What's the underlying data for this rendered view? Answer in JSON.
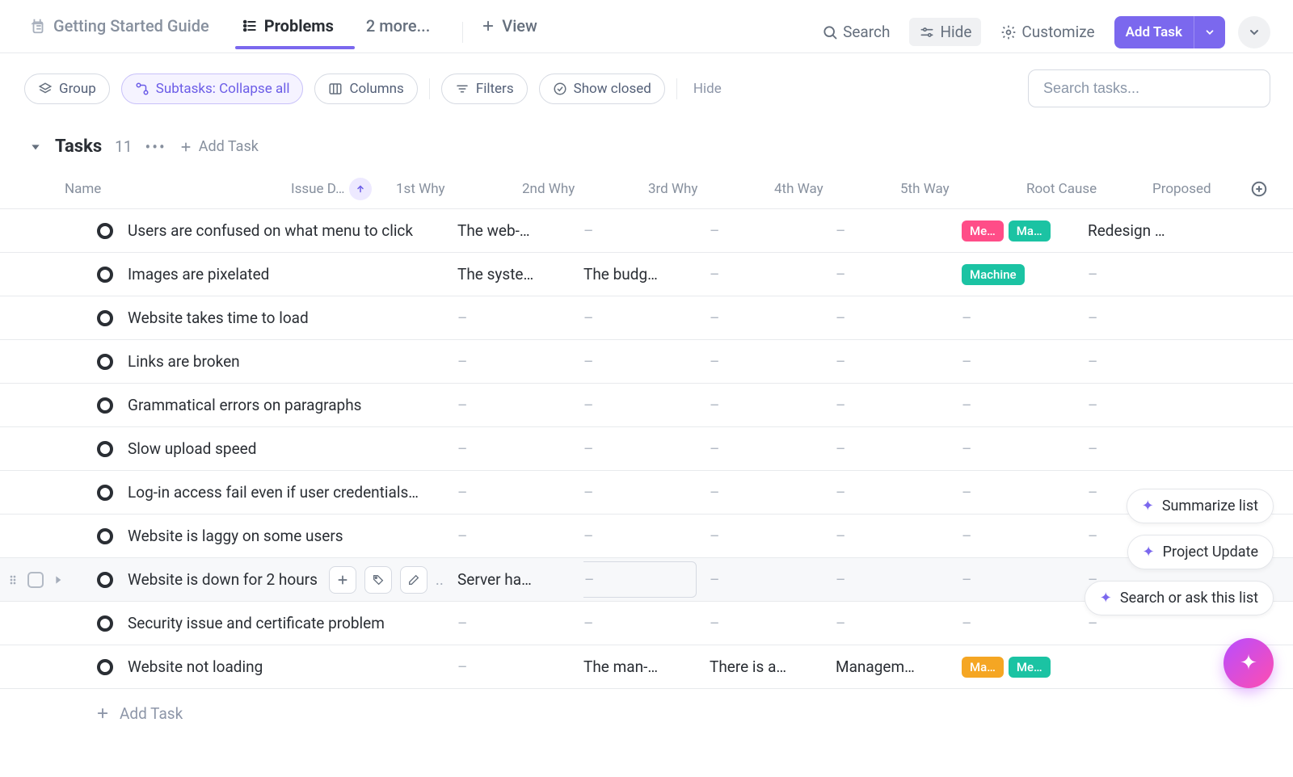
{
  "header": {
    "tabs": [
      {
        "id": "guide",
        "label": "Getting Started Guide",
        "icon": "doc-pin"
      },
      {
        "id": "problems",
        "label": "Problems",
        "icon": "list",
        "active": true
      },
      {
        "id": "more",
        "label": "2 more..."
      }
    ],
    "add_view_label": "View",
    "search_label": "Search",
    "hide_label": "Hide",
    "customize_label": "Customize",
    "add_task_label": "Add Task"
  },
  "filters": {
    "group_label": "Group",
    "subtasks_label": "Subtasks: Collapse all",
    "columns_label": "Columns",
    "filters_label": "Filters",
    "show_closed_label": "Show closed",
    "hide_label": "Hide",
    "search_placeholder": "Search tasks..."
  },
  "group": {
    "title": "Tasks",
    "count": "11",
    "add_task_label": "Add Task"
  },
  "columns": {
    "name": "Name",
    "issue": "Issue D…",
    "why1": "1st Why",
    "why2": "2nd Why",
    "why3": "3rd Why",
    "way4": "4th Way",
    "way5": "5th Way",
    "root": "Root Cause",
    "proposed": "Proposed"
  },
  "rows": [
    {
      "status": "yellow",
      "name": "Users are confused on what menu to click",
      "why1": ".",
      "why2": "The web-…",
      "why3": "–",
      "way4": "–",
      "way5": "–",
      "root_tags": [
        {
          "text": "Me…",
          "color": "pink"
        },
        {
          "text": "Ma…",
          "color": "teal"
        }
      ],
      "proposed": "Redesign …"
    },
    {
      "status": "orange",
      "name": "Images are pixelated",
      "why1": ".",
      "why2": "The syste…",
      "why3": "The budg…",
      "way4": "–",
      "way5": "–",
      "root_tags": [
        {
          "text": "Machine",
          "color": "teal",
          "wide": true
        }
      ],
      "proposed": "–"
    },
    {
      "status": "grey",
      "name": "Website takes time to load",
      "why1": "",
      "why2": "–",
      "why3": "–",
      "way4": "–",
      "way5": "–",
      "root_tags": [],
      "proposed": "–"
    },
    {
      "status": "grey",
      "name": "Links are broken",
      "why1": "",
      "why2": "–",
      "why3": "–",
      "way4": "–",
      "way5": "–",
      "root_tags": [],
      "proposed": "–"
    },
    {
      "status": "purple",
      "name": "Grammatical errors on paragraphs",
      "why1": "",
      "why2": "–",
      "why3": "–",
      "way4": "–",
      "way5": "–",
      "root_tags": [],
      "proposed": "–"
    },
    {
      "status": "grey",
      "name": "Slow upload speed",
      "why1": "",
      "why2": "–",
      "why3": "–",
      "way4": "–",
      "way5": "–",
      "root_tags": [],
      "proposed": "–"
    },
    {
      "status": "purple",
      "name": "Log-in access fail even if user credentials…",
      "why1": ".",
      "why2": "–",
      "why3": "–",
      "way4": "–",
      "way5": "–",
      "root_tags": [],
      "proposed": "–"
    },
    {
      "status": "purple",
      "name": "Website is laggy on some users",
      "why1": "",
      "why2": "–",
      "why3": "–",
      "way4": "–",
      "way5": "–",
      "root_tags": [],
      "proposed": "–"
    },
    {
      "status": "orange",
      "name": "Website is down for 2 hours",
      "why1": "..",
      "why2": "Server ha…",
      "why3": "–",
      "way4": "–",
      "way5": "–",
      "root_tags": [],
      "proposed": "–",
      "hovered": true
    },
    {
      "status": "grey",
      "name": "Security issue and certificate problem",
      "why1": "",
      "why2": "–",
      "why3": "–",
      "way4": "–",
      "way5": "–",
      "root_tags": [],
      "proposed": "–"
    },
    {
      "status": "purple",
      "name": "Website not loading",
      "why1": "",
      "why2": "–",
      "why3": "The man-…",
      "way4": "There is a…",
      "way5": "Managem…",
      "root_tags": [
        {
          "text": "Ma…",
          "color": "orange"
        },
        {
          "text": "Me…",
          "color": "teal"
        }
      ],
      "proposed": ""
    }
  ],
  "bottom_add_label": "Add Task",
  "ai_pills": {
    "summarize": "Summarize list",
    "project_update": "Project Update",
    "search_ask": "Search or ask this list"
  }
}
